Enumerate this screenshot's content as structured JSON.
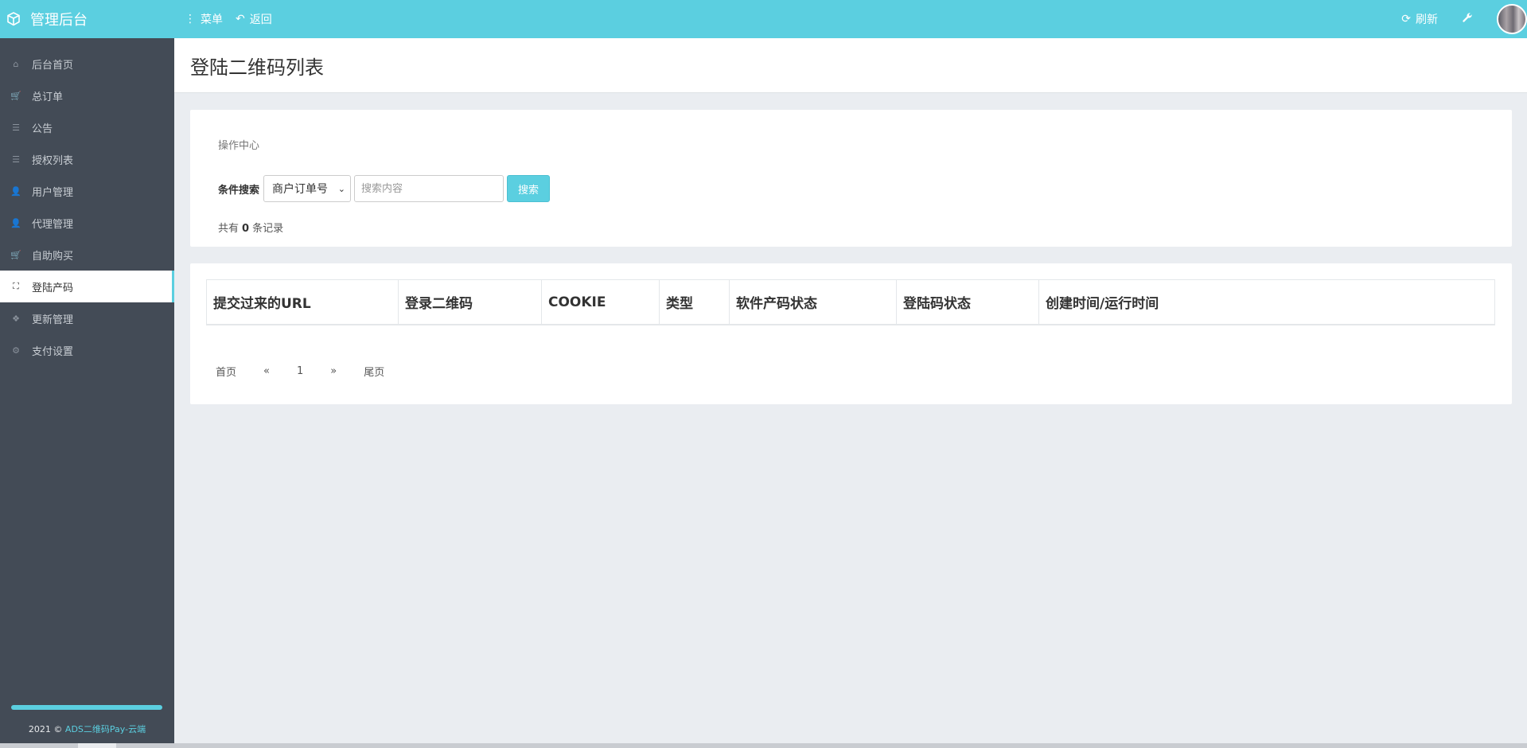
{
  "app": {
    "brand": "管理后台"
  },
  "topbar": {
    "menu_label": "菜单",
    "back_label": "返回",
    "refresh_label": "刷新"
  },
  "sidebar": {
    "items": [
      {
        "label": "后台首页",
        "icon": "home-icon",
        "glyph": "⌂"
      },
      {
        "label": "总订单",
        "icon": "cart-icon",
        "glyph": "🛒"
      },
      {
        "label": "公告",
        "icon": "list-icon",
        "glyph": "☰"
      },
      {
        "label": "授权列表",
        "icon": "list-icon",
        "glyph": "☰"
      },
      {
        "label": "用户管理",
        "icon": "user-icon",
        "glyph": "👤"
      },
      {
        "label": "代理管理",
        "icon": "user-icon",
        "glyph": "👤"
      },
      {
        "label": "自助购买",
        "icon": "cart-icon",
        "glyph": "🛒"
      },
      {
        "label": "登陆产码",
        "icon": "sitemap-icon",
        "glyph": "⛶",
        "active": true
      },
      {
        "label": "更新管理",
        "icon": "cubes-icon",
        "glyph": "❖"
      },
      {
        "label": "支付设置",
        "icon": "gears-icon",
        "glyph": "⚙"
      }
    ],
    "footer_prefix": "2021 © ",
    "footer_link": "ADS二维码Pay-云端"
  },
  "page": {
    "title": "登陆二维码列表"
  },
  "ops": {
    "title": "操作中心",
    "search_label": "条件搜索",
    "search_select_value": "商户订单号",
    "search_placeholder": "搜索内容",
    "search_button": "搜索",
    "count_prefix": "共有",
    "count_value": "0",
    "count_suffix": "条记录"
  },
  "table": {
    "columns": [
      "提交过来的URL",
      "登录二维码",
      "COOKIE",
      "类型",
      "软件产码状态",
      "登陆码状态",
      "创建时间/运行时间"
    ]
  },
  "pagination": {
    "first": "首页",
    "prev": "«",
    "current": "1",
    "next": "»",
    "last": "尾页"
  },
  "colors": {
    "accent": "#5bcfe0",
    "sidebar_bg": "#434b56",
    "content_bg": "#eaedf1"
  }
}
